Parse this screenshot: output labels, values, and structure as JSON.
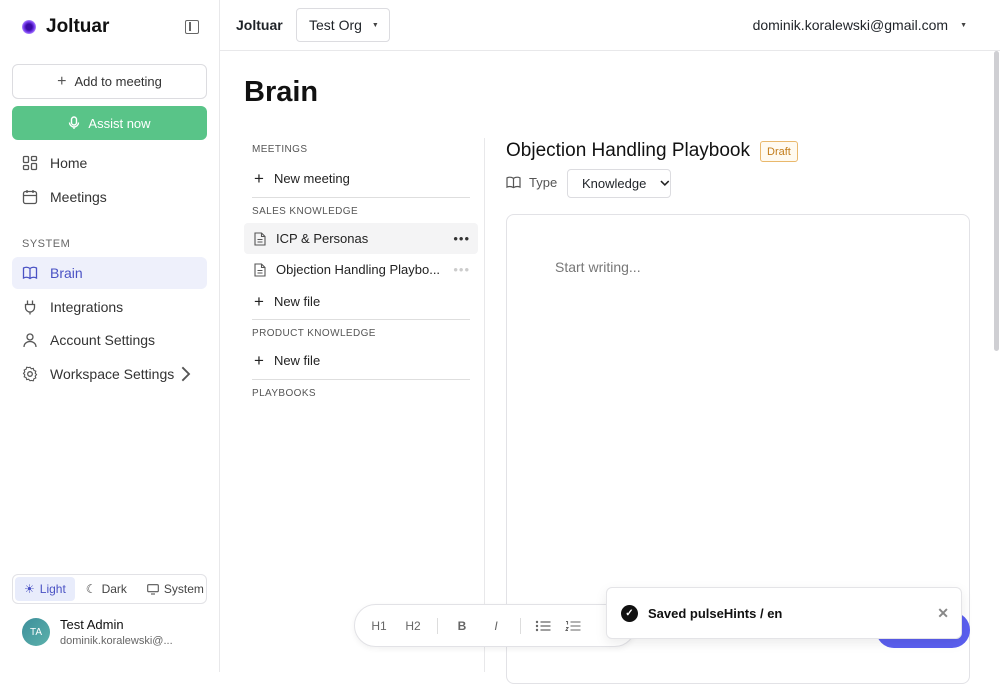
{
  "app": {
    "name": "Joltuar"
  },
  "sidebar": {
    "add_to_meeting": "Add to meeting",
    "assist_now": "Assist now",
    "nav": [
      {
        "label": "Home",
        "icon": "home-grid-icon"
      },
      {
        "label": "Meetings",
        "icon": "calendar-icon"
      }
    ],
    "system_label": "SYSTEM",
    "system_items": [
      {
        "label": "Brain",
        "icon": "book-icon",
        "active": true
      },
      {
        "label": "Integrations",
        "icon": "plug-icon"
      },
      {
        "label": "Account Settings",
        "icon": "user-icon"
      },
      {
        "label": "Workspace Settings",
        "icon": "gear-icon"
      }
    ],
    "theme": {
      "light": "Light",
      "dark": "Dark",
      "system": "System",
      "selected": "Light"
    },
    "user": {
      "initials": "TA",
      "name": "Test Admin",
      "email": "dominik.koralewski@..."
    }
  },
  "topbar": {
    "title": "Joltuar",
    "org": "Test Org",
    "user_email": "dominik.koralewski@gmail.com"
  },
  "page": {
    "title": "Brain"
  },
  "list": {
    "meetings_label": "MEETINGS",
    "new_meeting": "New meeting",
    "sales_label": "SALES KNOWLEDGE",
    "sales_files": [
      "ICP & Personas",
      "Objection Handling Playbo..."
    ],
    "new_file": "New file",
    "product_label": "PRODUCT KNOWLEDGE",
    "playbooks_label": "PLAYBOOKS"
  },
  "document": {
    "title": "Objection Handling Playbook",
    "status": "Draft",
    "type_label": "Type",
    "type_value": "Knowledge",
    "placeholder": "Start writing..."
  },
  "toolbar": {
    "h1": "H1",
    "h2": "H2",
    "bold": "B",
    "italic": "I"
  },
  "toast": {
    "message": "Saved pulseHints / en"
  }
}
